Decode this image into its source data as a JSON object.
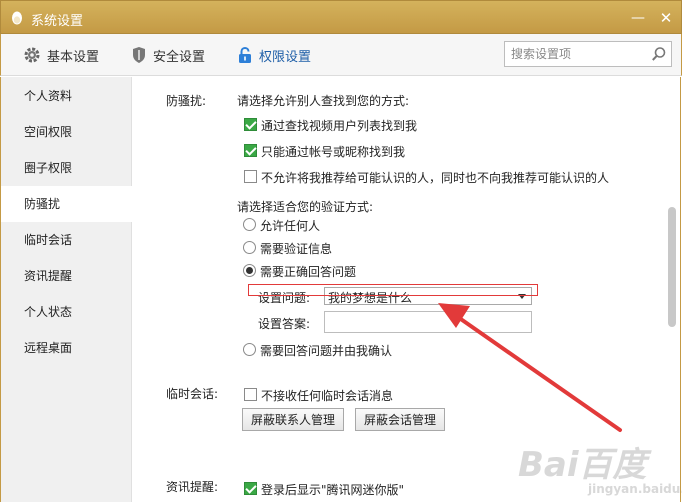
{
  "window": {
    "title": "系统设置",
    "min_glyph": "—",
    "close_glyph": "✕"
  },
  "toolbar": {
    "tabs": [
      {
        "label": "基本设置",
        "icon": "gear-icon"
      },
      {
        "label": "安全设置",
        "icon": "shield-icon"
      },
      {
        "label": "权限设置",
        "icon": "lock-icon",
        "active": true
      }
    ],
    "search_placeholder": "搜索设置项"
  },
  "sidebar": {
    "items": [
      {
        "label": "个人资料"
      },
      {
        "label": "空间权限"
      },
      {
        "label": "圈子权限"
      },
      {
        "label": "防骚扰",
        "active": true
      },
      {
        "label": "临时会话"
      },
      {
        "label": "资讯提醒"
      },
      {
        "label": "个人状态"
      },
      {
        "label": "远程桌面"
      }
    ]
  },
  "anti_harass": {
    "section_label": "防骚扰:",
    "find_prompt": "请选择允许别人查找到您的方式:",
    "find_options": [
      {
        "label": "通过查找视频用户列表找到我",
        "checked": true
      },
      {
        "label": "只能通过帐号或昵称找到我",
        "checked": true
      },
      {
        "label": "不允许将我推荐给可能认识的人，同时也不向我推荐可能认识的人",
        "checked": false
      }
    ],
    "verify_prompt": "请选择适合您的验证方式:",
    "verify_options": [
      {
        "label": "允许任何人",
        "checked": false
      },
      {
        "label": "需要验证信息",
        "checked": false
      },
      {
        "label": "需要正确回答问题",
        "checked": true
      },
      {
        "label": "需要回答问题并由我确认",
        "checked": false
      }
    ],
    "question_label": "设置问题:",
    "question_value": "我的梦想是什么",
    "answer_label": "设置答案:",
    "answer_value": ""
  },
  "temp_chat": {
    "section_label": "临时会话:",
    "option": {
      "label": "不接收任何临时会话消息",
      "checked": false
    },
    "btn_contacts": "屏蔽联系人管理",
    "btn_sessions": "屏蔽会话管理"
  },
  "news": {
    "section_label": "资讯提醒:",
    "option": {
      "label": "登录后显示\"腾讯网迷你版\"",
      "checked": true
    }
  },
  "watermark": {
    "brand": "Bai百度",
    "sub": "jingyan.baidu.com"
  }
}
